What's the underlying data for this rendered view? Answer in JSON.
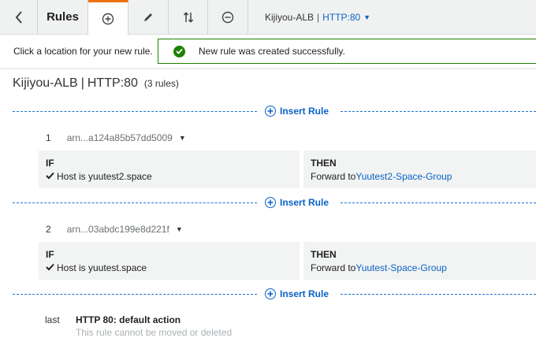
{
  "toolbar": {
    "back_icon": "chevron-left-icon",
    "rules_label": "Rules",
    "add_icon": "plus-circle-icon",
    "edit_icon": "pencil-icon",
    "reorder_icon": "reorder-arrows-icon",
    "delete_icon": "minus-circle-icon",
    "load_balancer": "Kijiyou-ALB",
    "separator": "|",
    "listener": "HTTP:80",
    "active_tab_color": "#ec7211"
  },
  "hint": "Click a location for your new rule.",
  "flash": {
    "message": "New rule was created successfully.",
    "color": "#1d8102"
  },
  "header": {
    "load_balancer": "Kijiyou-ALB",
    "separator": "|",
    "listener": "HTTP:80",
    "count": "(3 rules)"
  },
  "insert_label": "Insert Rule",
  "rules": [
    {
      "number": "1",
      "arn": "arn...a124a85b57dd5009",
      "if_label": "IF",
      "condition": "Host is yuutest2.space",
      "then_label": "THEN",
      "action_prefix": "Forward to",
      "target": "Yuutest2-Space-Group"
    },
    {
      "number": "2",
      "arn": "arn...03abdc199e8d221f",
      "if_label": "IF",
      "condition": "Host is yuutest.space",
      "then_label": "THEN",
      "action_prefix": "Forward to",
      "target": "Yuutest-Space-Group"
    }
  ],
  "default_rule": {
    "label": "last",
    "action": "HTTP 80: default action",
    "note": "This rule cannot be moved or deleted"
  },
  "colors": {
    "link": "#0a63c7",
    "dash": "#1a73d9",
    "box_bg": "#f2f3f3"
  }
}
